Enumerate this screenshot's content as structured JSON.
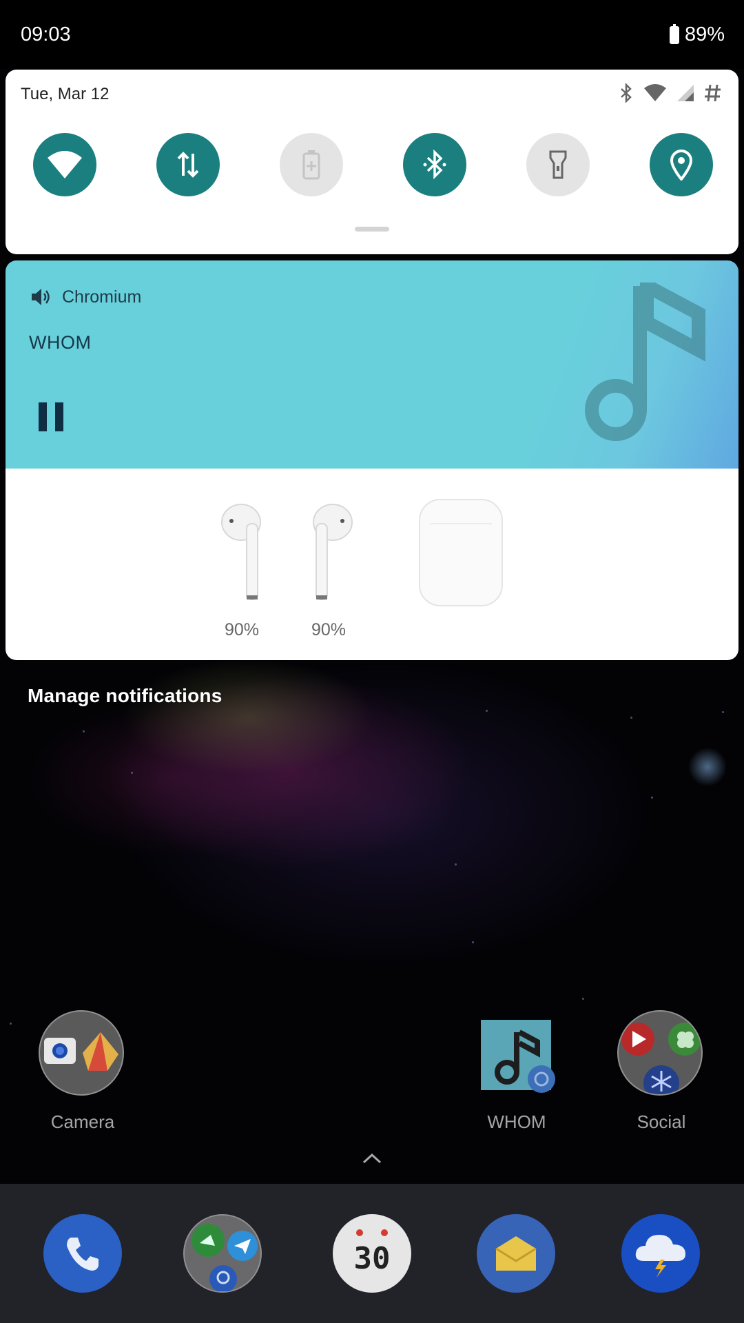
{
  "status_bar": {
    "time": "09:03",
    "battery": "89%"
  },
  "quick_settings": {
    "date": "Tue, Mar 12",
    "tiles": [
      {
        "name": "wifi",
        "icon": "wifi-icon",
        "state": "on"
      },
      {
        "name": "mobile-data",
        "icon": "data-arrows-icon",
        "state": "on"
      },
      {
        "name": "battery-saver",
        "icon": "battery-saver-icon",
        "state": "off"
      },
      {
        "name": "bluetooth",
        "icon": "bluetooth-icon",
        "state": "on"
      },
      {
        "name": "flashlight",
        "icon": "flashlight-icon",
        "state": "off"
      },
      {
        "name": "location",
        "icon": "location-pin-icon",
        "state": "on"
      }
    ],
    "accent_color": "#1b7f7f"
  },
  "media_notification": {
    "app_name": "Chromium",
    "title": "WHOM",
    "background_color": "#68d0db"
  },
  "airpods": {
    "left_battery": "90%",
    "right_battery": "90%"
  },
  "manage_notifications": "Manage notifications",
  "home_screen": {
    "apps": [
      {
        "label": "Camera",
        "icon": "camera-folder-icon"
      },
      {
        "label": "WHOM",
        "icon": "music-note-icon"
      },
      {
        "label": "Social",
        "icon": "social-folder-icon"
      }
    ],
    "dock": [
      {
        "name": "phone",
        "icon": "phone-icon"
      },
      {
        "name": "messaging",
        "icon": "messaging-folder-icon"
      },
      {
        "name": "calendar",
        "icon": "calendar-icon",
        "text": "30"
      },
      {
        "name": "email",
        "icon": "mail-icon"
      },
      {
        "name": "weather",
        "icon": "weather-storm-icon"
      }
    ]
  }
}
